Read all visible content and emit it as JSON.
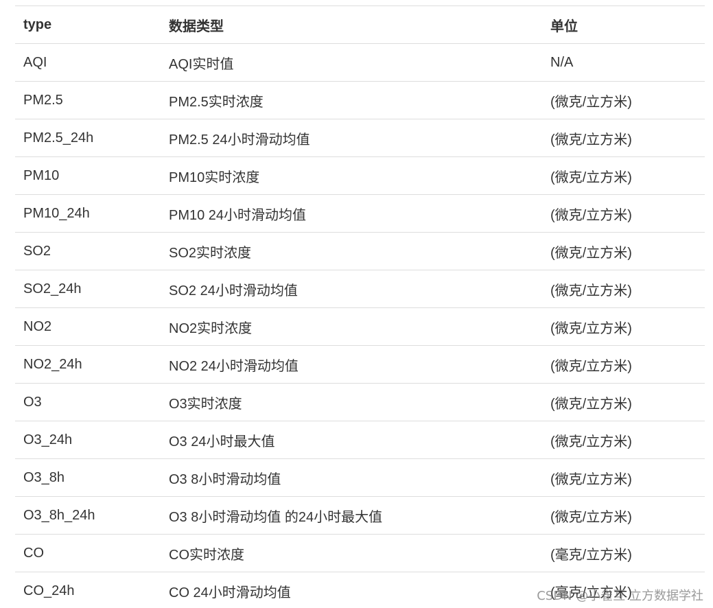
{
  "table": {
    "headers": [
      "type",
      "数据类型",
      "单位"
    ],
    "rows": [
      [
        "AQI",
        "AQI实时值",
        "N/A"
      ],
      [
        "PM2.5",
        "PM2.5实时浓度",
        "(微克/立方米)"
      ],
      [
        "PM2.5_24h",
        "PM2.5 24小时滑动均值",
        "(微克/立方米)"
      ],
      [
        "PM10",
        "PM10实时浓度",
        "(微克/立方米)"
      ],
      [
        "PM10_24h",
        "PM10 24小时滑动均值",
        "(微克/立方米)"
      ],
      [
        "SO2",
        "SO2实时浓度",
        "(微克/立方米)"
      ],
      [
        "SO2_24h",
        "SO2 24小时滑动均值",
        "(微克/立方米)"
      ],
      [
        "NO2",
        "NO2实时浓度",
        "(微克/立方米)"
      ],
      [
        "NO2_24h",
        "NO2 24小时滑动均值",
        "(微克/立方米)"
      ],
      [
        "O3",
        "O3实时浓度",
        "(微克/立方米)"
      ],
      [
        "O3_24h",
        "O3 24小时最大值",
        "(微克/立方米)"
      ],
      [
        "O3_8h",
        "O3 8小时滑动均值",
        "(微克/立方米)"
      ],
      [
        "O3_8h_24h",
        "O3 8小时滑动均值 的24小时最大值",
        "(微克/立方米)"
      ],
      [
        "CO",
        "CO实时浓度",
        "(毫克/立方米)"
      ],
      [
        "CO_24h",
        "CO 24小时滑动均值",
        "(毫克/立方米)"
      ]
    ]
  },
  "watermark": "CSDN @小雀互 立方数据学社"
}
